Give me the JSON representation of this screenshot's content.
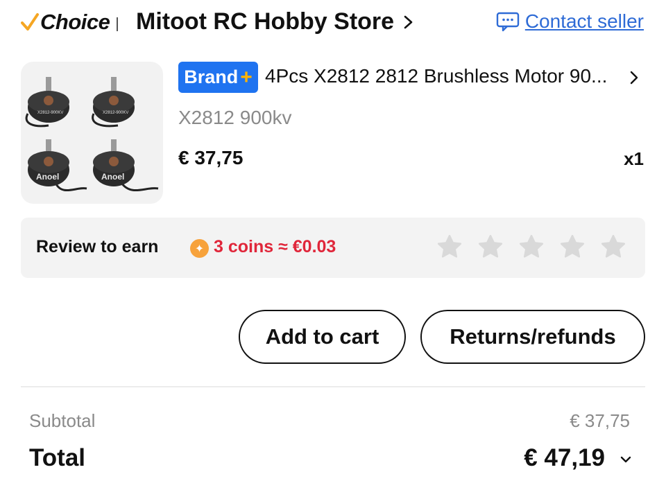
{
  "header": {
    "choice_label": "Choice",
    "store_name": "Mitoot RC Hobby Store",
    "contact_label": "Contact seller",
    "icons": [
      "check-icon",
      "chevron-right-icon",
      "chat-icon"
    ]
  },
  "product": {
    "badge_text": "Brand",
    "badge_plus": "+",
    "title": "4Pcs X2812 2812 Brushless Motor 90...",
    "variant": "X2812 900kv",
    "price": "€ 37,75",
    "quantity": "x1",
    "thumb_marks": [
      "X2812-900KV",
      "Anoel"
    ]
  },
  "review": {
    "label": "Review to earn",
    "reward": "3 coins ≈ €0.03",
    "star_count": 5,
    "rating": 0
  },
  "actions": {
    "add_to_cart": "Add to cart",
    "returns": "Returns/refunds"
  },
  "summary": {
    "subtotal_label": "Subtotal",
    "subtotal_value": "€ 37,75",
    "total_label": "Total",
    "total_value": "€ 47,19"
  },
  "colors": {
    "accent_blue": "#1f73f0",
    "link_blue": "#2e6bd6",
    "reward_red": "#e0263a",
    "coin_orange": "#f7a23b",
    "choice_check": "#f5a623"
  }
}
